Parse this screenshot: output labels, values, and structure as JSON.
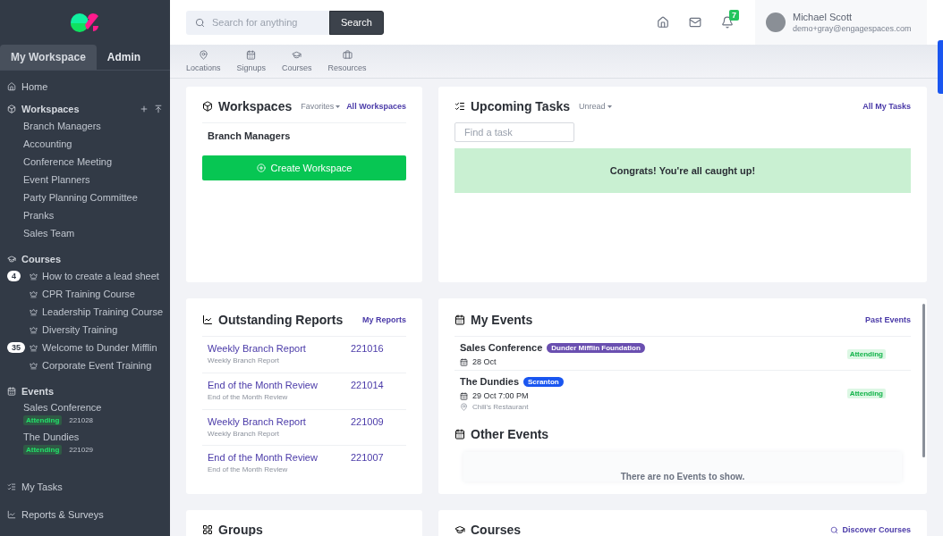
{
  "sidebar": {
    "tabs": [
      {
        "label": "My Workspace",
        "selected": true
      },
      {
        "label": "Admin",
        "selected": false
      }
    ],
    "home": "Home",
    "workspaces": {
      "title": "Workspaces",
      "items": [
        "Branch Managers",
        "Accounting",
        "Conference Meeting",
        "Event Planners",
        "Party Planning Committee",
        "Pranks",
        "Sales Team"
      ]
    },
    "courses": {
      "title": "Courses",
      "items": [
        {
          "label": "How to create a lead sheet",
          "count": "4"
        },
        {
          "label": "CPR Training Course"
        },
        {
          "label": "Leadership Training Course"
        },
        {
          "label": "Diversity Training"
        },
        {
          "label": "Welcome to Dunder Mifflin",
          "count": "35"
        },
        {
          "label": "Corporate Event Training"
        }
      ]
    },
    "events": {
      "title": "Events",
      "items": [
        {
          "name": "Sales Conference",
          "status": "Attending",
          "code": "221028"
        },
        {
          "name": "The Dundies",
          "status": "Attending",
          "code": "221029"
        }
      ]
    },
    "bottom": [
      {
        "kind": "tasks",
        "label": "My Tasks"
      },
      {
        "kind": "reports",
        "label": "Reports & Surveys"
      }
    ]
  },
  "header": {
    "search": {
      "placeholder": "Search for anything",
      "button": "Search"
    },
    "notifications": "7",
    "user": {
      "name": "Michael Scott",
      "email": "demo+gray@engagespaces.com"
    }
  },
  "subnav": [
    {
      "kind": "locations",
      "label": "Locations"
    },
    {
      "kind": "signups",
      "label": "Signups"
    },
    {
      "kind": "courses",
      "label": "Courses"
    },
    {
      "kind": "resources",
      "label": "Resources"
    }
  ],
  "workspaces_card": {
    "title": "Workspaces",
    "filter": "Favorites",
    "link": "All Workspaces",
    "items": [
      "Branch Managers"
    ],
    "button": "Create Workspace"
  },
  "tasks_card": {
    "title": "Upcoming Tasks",
    "filter": "Unread",
    "link": "All My Tasks",
    "placeholder": "Find a task",
    "message": "Congrats! You're all caught up!"
  },
  "reports_card": {
    "title": "Outstanding Reports",
    "link": "My Reports",
    "rows": [
      {
        "title": "Weekly Branch Report",
        "subtitle": "Weekly Branch Report",
        "code": "221016"
      },
      {
        "title": "End of the Month Review",
        "subtitle": "End of the Month Review",
        "code": "221014"
      },
      {
        "title": "Weekly Branch Report",
        "subtitle": "Weekly Branch Report",
        "code": "221009"
      },
      {
        "title": "End of the Month Review",
        "subtitle": "End of the Month Review",
        "code": "221007"
      }
    ]
  },
  "events_card": {
    "title": "My Events",
    "link": "Past Events",
    "events": [
      {
        "name": "Sales Conference",
        "tag": "Dunder Mifflin Foundation",
        "color": "#6a4fb0",
        "date": "28 Oct",
        "status": "Attending"
      },
      {
        "name": "The Dundies",
        "tag": "Scranton",
        "color": "#1a56f0",
        "date": "29 Oct  7:00 PM",
        "location": "Chili's Restaurant",
        "status": "Attending"
      }
    ],
    "other_title": "Other Events",
    "empty": "There are no Events to show."
  },
  "groups_card": {
    "title": "Groups"
  },
  "courses_card": {
    "title": "Courses",
    "link": "Discover Courses"
  }
}
